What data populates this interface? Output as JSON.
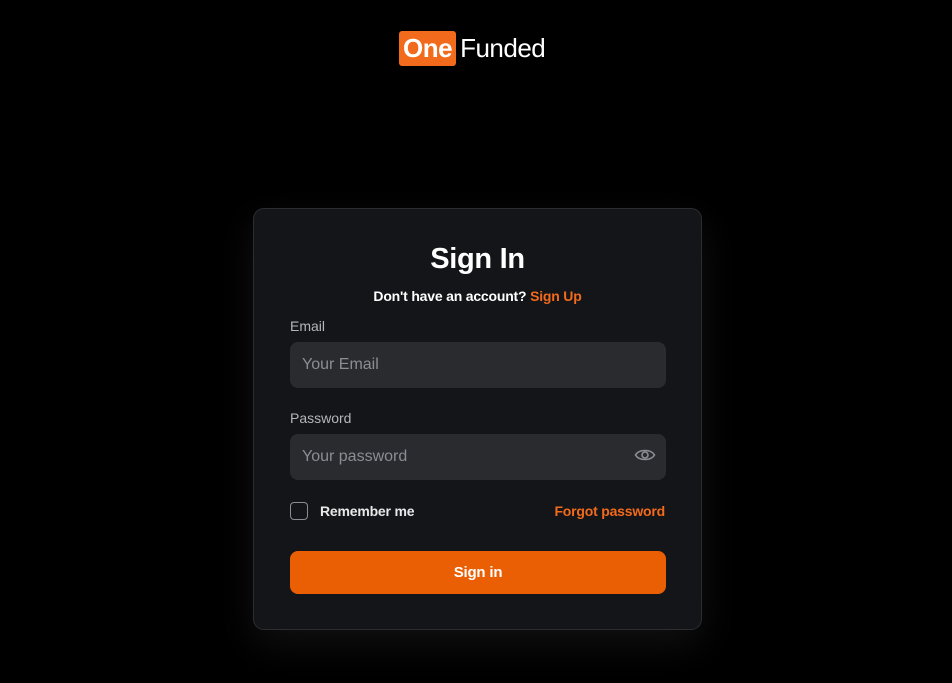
{
  "brand": {
    "logo_mark": "One",
    "logo_text": "Funded",
    "accent_color": "#f26a1b"
  },
  "form": {
    "title": "Sign In",
    "subtitle_prefix": "Don't have an account?",
    "signup_link": "Sign Up",
    "email": {
      "label": "Email",
      "placeholder": "Your Email",
      "value": ""
    },
    "password": {
      "label": "Password",
      "placeholder": "Your password",
      "value": "",
      "toggle_icon": "eye-icon"
    },
    "remember_label": "Remember me",
    "remember_checked": false,
    "forgot_label": "Forgot password",
    "submit_label": "Sign in"
  }
}
